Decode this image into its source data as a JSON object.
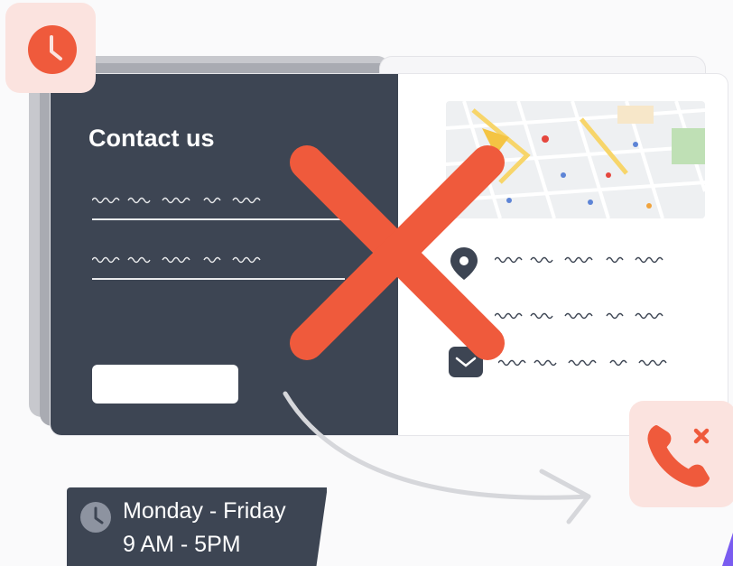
{
  "contact_panel": {
    "title": "Contact us"
  },
  "hours": {
    "days": "Monday - Friday",
    "times": "9 AM - 5PM"
  },
  "icons": {
    "top_left": "clock-icon",
    "bottom_right": "phone-missed-icon",
    "location": "map-pin-icon",
    "email": "envelope-icon",
    "hours": "clock-icon"
  },
  "colors": {
    "accent": "#ef5a3c",
    "dark_panel": "#3d4553",
    "badge_bg": "#fbe3df"
  }
}
